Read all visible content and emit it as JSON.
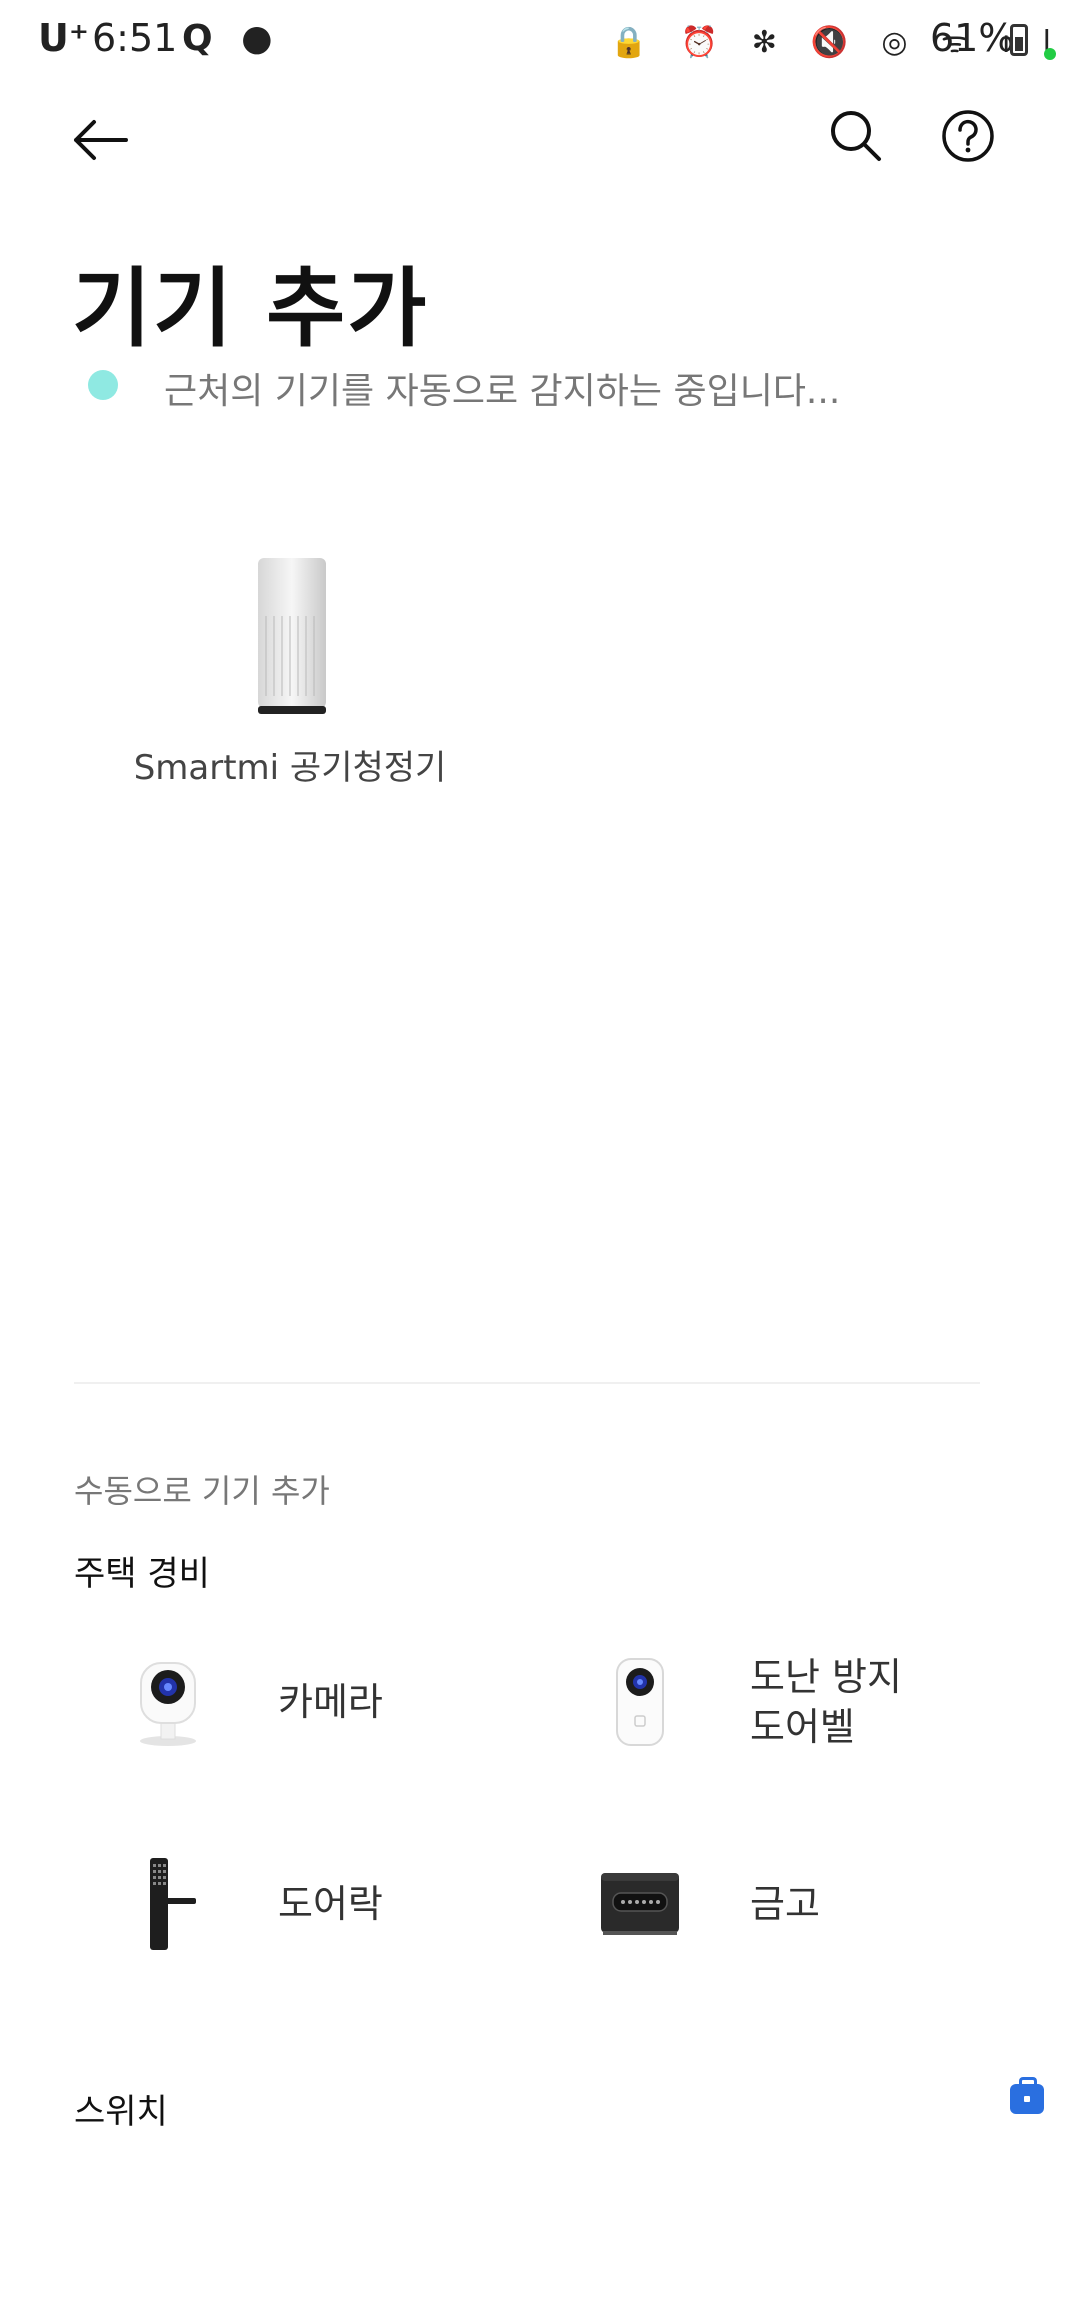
{
  "status_bar": {
    "carrier": "U⁺",
    "time": "6:51",
    "left_icons": "Q ●",
    "right_icons": "🔒 ⏰ ✻ 🔇 ◎ ᯤ ıll",
    "battery": "61%"
  },
  "header": {
    "back_icon": "arrow-left-icon",
    "search_icon": "search-icon",
    "help_icon": "help-circle-icon"
  },
  "title": "기기 추가",
  "scan_status": "근처의 기기를 자동으로 감지하는 중입니다...",
  "discovered_devices": [
    {
      "name": "Smartmi 공기청정기",
      "icon": "air-purifier"
    }
  ],
  "manual": {
    "title": "수동으로 기기 추가",
    "categories": [
      {
        "name": "주택 경비",
        "items": [
          {
            "label": "카메라",
            "icon": "camera"
          },
          {
            "label": "도난 방지\n도어벨",
            "icon": "doorbell"
          },
          {
            "label": "도어락",
            "icon": "door-lock"
          },
          {
            "label": "금고",
            "icon": "safe"
          }
        ]
      },
      {
        "name": "스위치",
        "items": []
      }
    ]
  },
  "colors": {
    "scan_dot": "#8fe9e2",
    "accent": "#2a6fe0"
  }
}
